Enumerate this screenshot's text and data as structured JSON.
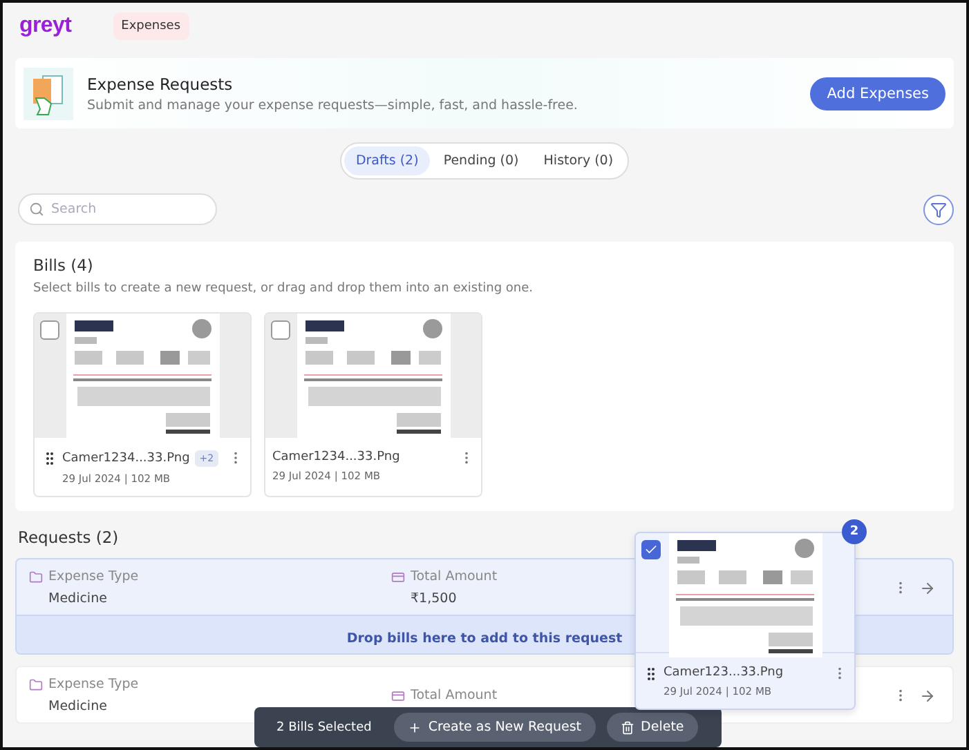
{
  "app": {
    "logo": "greyt",
    "nav": [
      {
        "label": "Expenses",
        "selected": true
      }
    ]
  },
  "banner": {
    "title": "Expense Requests",
    "subtitle": "Submit and manage your expense requests—simple, fast, and hassle-free.",
    "button": "Add Expenses"
  },
  "tabs": [
    {
      "label": "Drafts (2)",
      "selected": true
    },
    {
      "label": "Pending (0)",
      "selected": false
    },
    {
      "label": "History (0)",
      "selected": false
    }
  ],
  "search": {
    "placeholder": "Search"
  },
  "bills": {
    "title": "Bills (4)",
    "subtitle": "Select bills to create a new request, or drag and drop them into an existing one.",
    "items": [
      {
        "name": "Camer1234...33.Png",
        "meta": "29 Jul 2024 | 102 MB",
        "extra": "+2",
        "checked": false
      },
      {
        "name": "Camer1234...33.Png",
        "meta": "29 Jul 2024 | 102 MB",
        "checked": false
      }
    ]
  },
  "requests": {
    "title": "Requests (2)",
    "items": [
      {
        "highlighted": true,
        "fields": [
          {
            "kind": "type",
            "label": "Expense Type",
            "value": "Medicine"
          },
          {
            "kind": "amount",
            "label": "Total Amount",
            "value": "₹1,500"
          }
        ],
        "drop_hint": "Drop bills here to add to this request"
      },
      {
        "highlighted": false,
        "fields": [
          {
            "kind": "type",
            "label": "Expense Type",
            "value": "Medicine"
          },
          {
            "kind": "amount",
            "label": "Total Amount"
          }
        ]
      }
    ]
  },
  "dragged_bill": {
    "name": "Camer123...33.Png",
    "meta": "29 Jul 2024 | 102 MB",
    "checked": true,
    "count": "2"
  },
  "selection_bar": {
    "label": "2 Bills Selected",
    "actions": [
      {
        "kind": "create",
        "label": "Create as New Request"
      },
      {
        "kind": "delete",
        "label": "Delete"
      }
    ]
  }
}
